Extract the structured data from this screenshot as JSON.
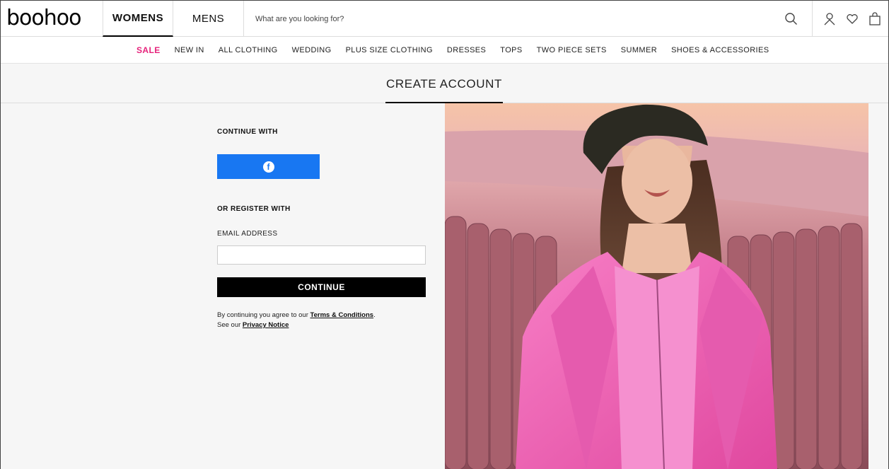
{
  "header": {
    "logo": "boohoo",
    "tabs": [
      {
        "label": "WOMENS",
        "active": true
      },
      {
        "label": "MENS",
        "active": false
      }
    ],
    "search_placeholder": "What are you looking for?",
    "icons": [
      "search-icon",
      "account-icon",
      "wishlist-heart-icon",
      "bag-icon"
    ]
  },
  "nav": {
    "items": [
      "SALE",
      "NEW IN",
      "ALL CLOTHING",
      "WEDDING",
      "PLUS SIZE CLOTHING",
      "DRESSES",
      "TOPS",
      "TWO PIECE SETS",
      "SUMMER",
      "SHOES & ACCESSORIES"
    ]
  },
  "page": {
    "title": "CREATE ACCOUNT"
  },
  "form": {
    "continue_with": "CONTINUE WITH",
    "facebook_icon": "f",
    "or_register": "OR REGISTER WITH",
    "email_label": "EMAIL ADDRESS",
    "email_value": "",
    "continue_label": "CONTINUE",
    "legal_prefix": "By continuing you agree to our ",
    "terms_link": "Terms & Conditions",
    "legal_mid": ".",
    "legal_see": "See our ",
    "privacy_link": "Privacy Notice"
  },
  "colors": {
    "sale": "#e6237b",
    "facebook": "#1877f2",
    "button": "#000000",
    "coat": "#f05fb6"
  }
}
